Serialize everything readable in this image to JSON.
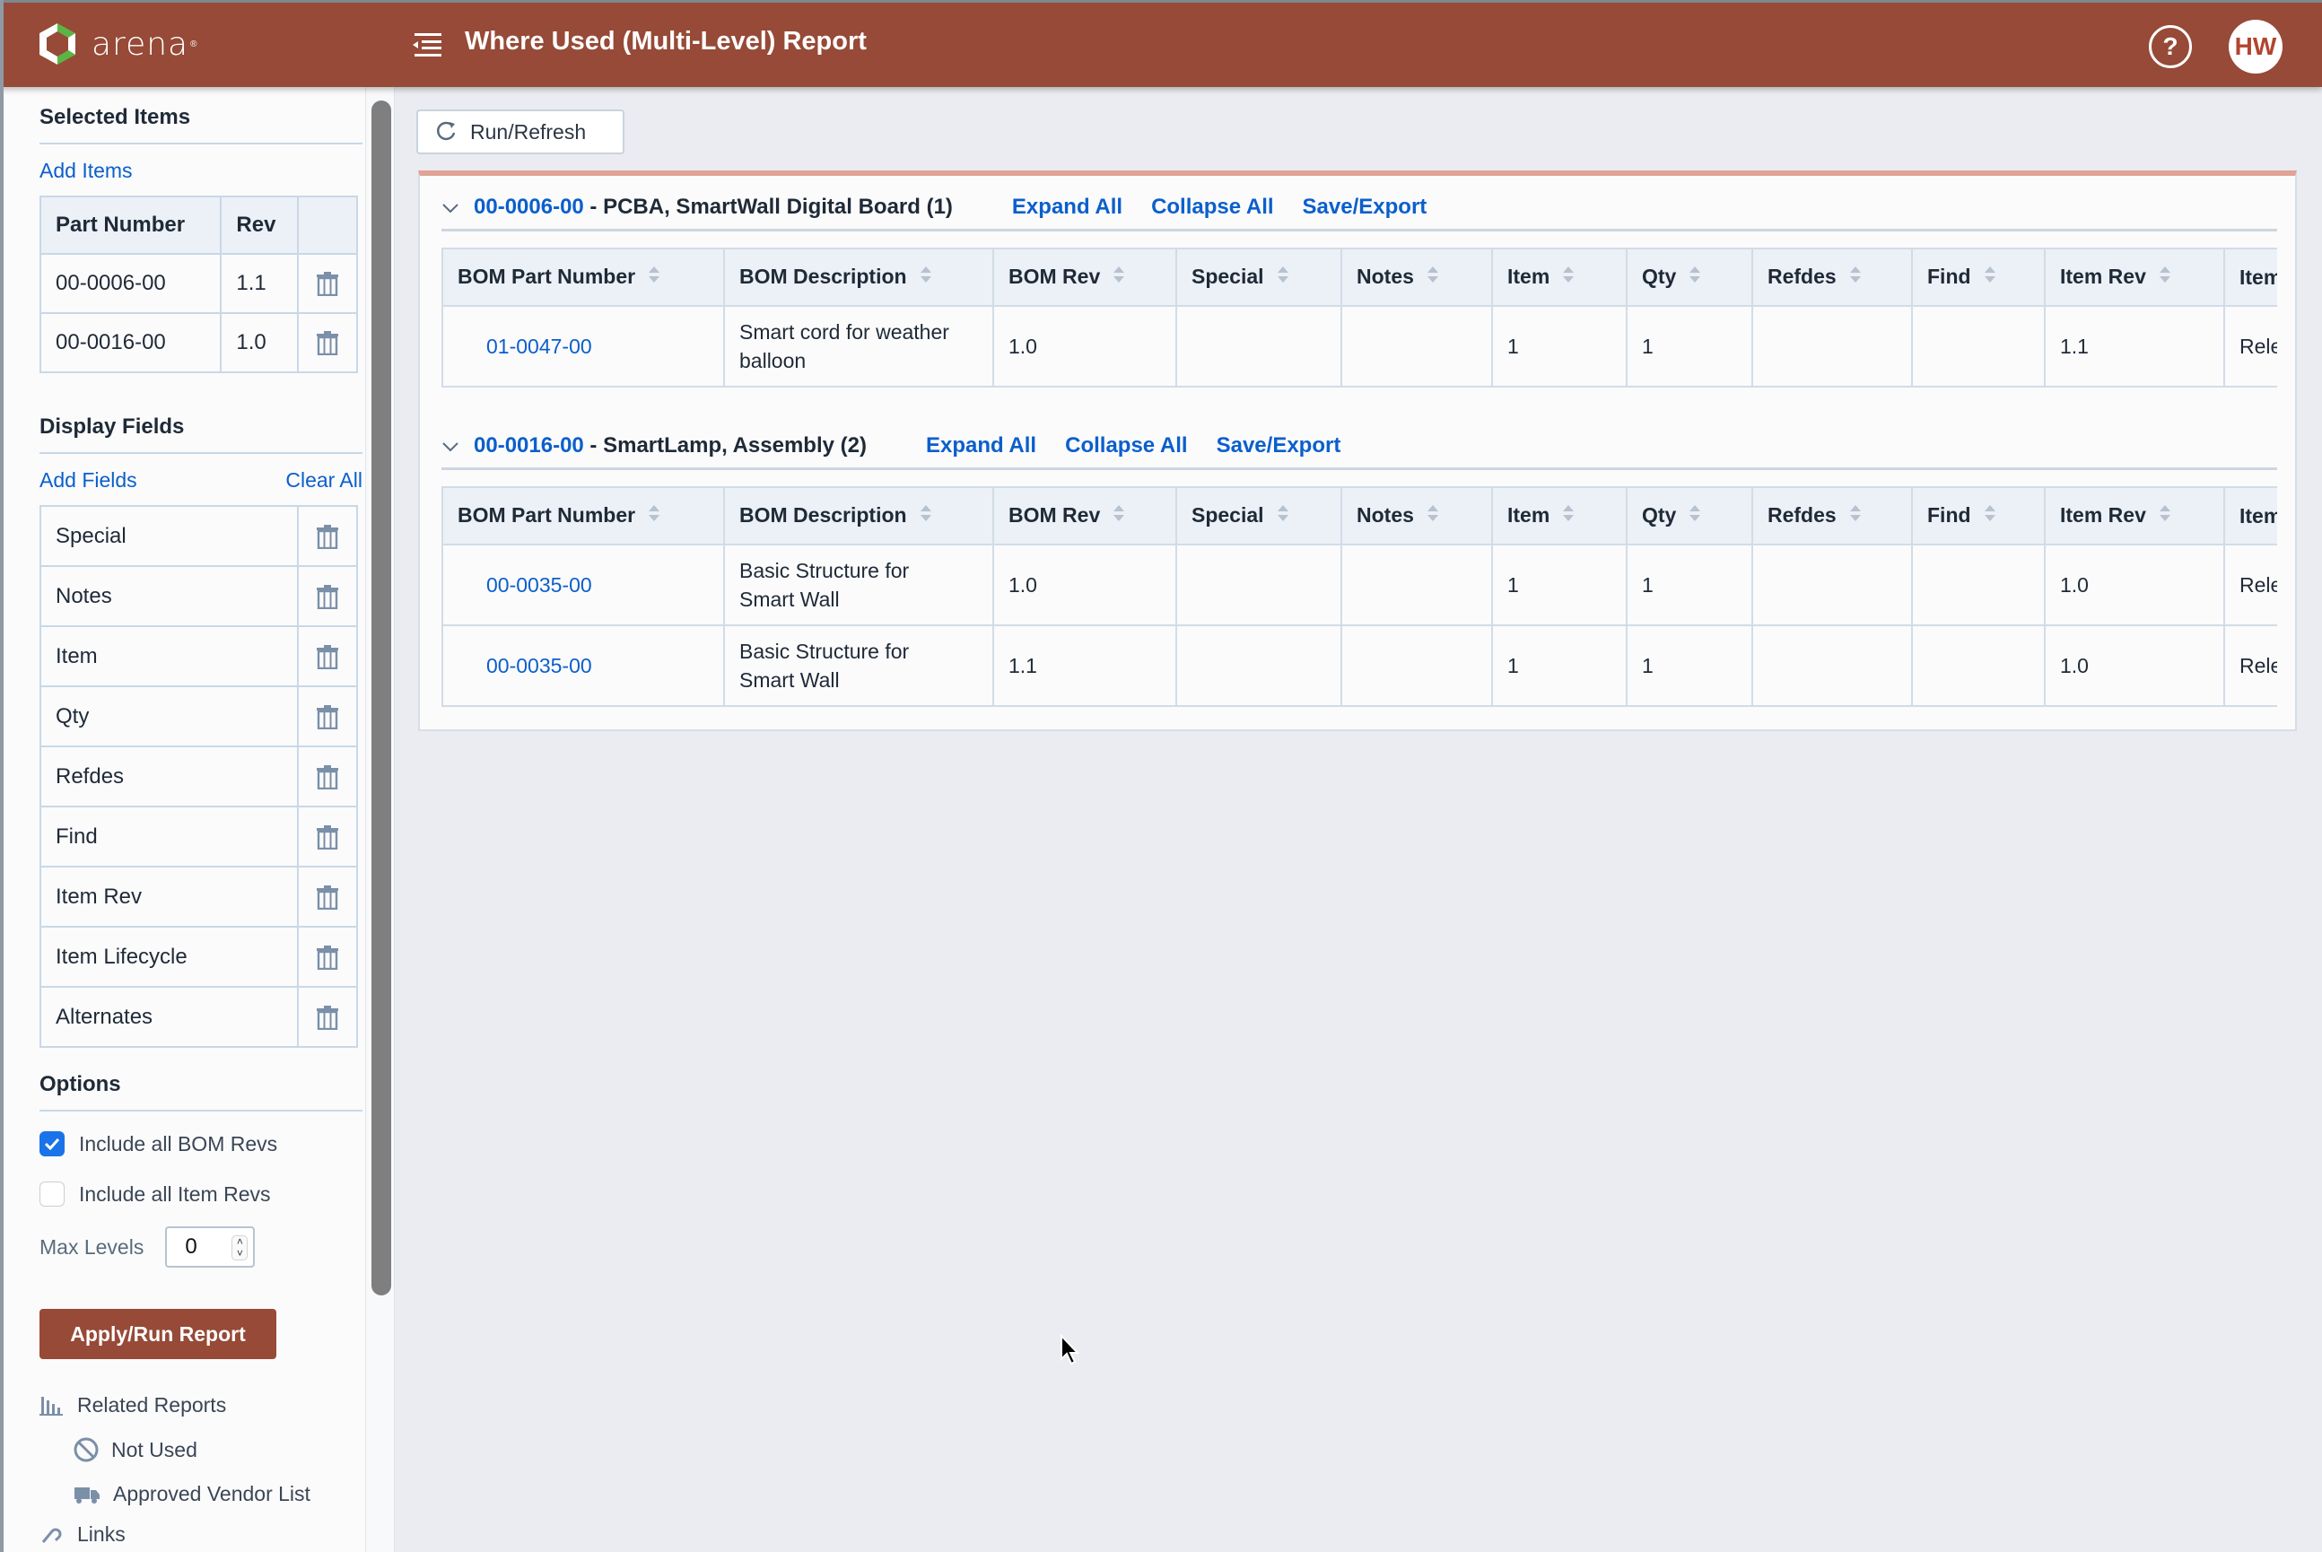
{
  "app": {
    "brand": "arena",
    "brand_mark": "®",
    "title": "Where Used (Multi-Level) Report",
    "help_label": "?",
    "user_initials": "HW",
    "colors": {
      "header": "#964a37",
      "link": "#0b5fcc",
      "accent_border": "#e0a395",
      "checkbox": "#1a73e8"
    }
  },
  "sidebar": {
    "selected_items": {
      "heading": "Selected Items",
      "add_link": "Add Items",
      "columns": [
        "Part Number",
        "Rev"
      ],
      "rows": [
        {
          "part": "00-0006-00",
          "rev": "1.1"
        },
        {
          "part": "00-0016-00",
          "rev": "1.0"
        }
      ]
    },
    "display_fields": {
      "heading": "Display Fields",
      "add_link": "Add Fields",
      "clear_link": "Clear All",
      "fields": [
        "Special",
        "Notes",
        "Item",
        "Qty",
        "Refdes",
        "Find",
        "Item Rev",
        "Item Lifecycle",
        "Alternates"
      ]
    },
    "options": {
      "heading": "Options",
      "include_bom_revs": {
        "label": "Include all BOM Revs",
        "checked": true
      },
      "include_item_revs": {
        "label": "Include all Item Revs",
        "checked": false
      },
      "max_levels_label": "Max Levels",
      "max_levels_value": "0"
    },
    "apply_button": "Apply/Run Report",
    "related_reports": {
      "heading": "Related Reports",
      "items": [
        {
          "label": "Not Used",
          "icon": "not-allowed-icon"
        },
        {
          "label": "Approved Vendor List",
          "icon": "truck-icon"
        }
      ],
      "next_partial": "Links"
    }
  },
  "main": {
    "run_refresh": "Run/Refresh",
    "columns": [
      "BOM Part Number",
      "BOM Description",
      "BOM Rev",
      "Special",
      "Notes",
      "Item",
      "Qty",
      "Refdes",
      "Find",
      "Item Rev",
      "Item Lifecycle"
    ],
    "groups": [
      {
        "part": "00-0006-00",
        "desc": " - PCBA, SmartWall Digital Board (1)",
        "expand": "Expand All",
        "collapse": "Collapse All",
        "export": "Save/Export",
        "rows": [
          [
            "01-0047-00",
            "Smart cord for weather balloon",
            "1.0",
            "",
            "",
            "1",
            "1",
            "",
            "",
            "1.1",
            "Released"
          ]
        ]
      },
      {
        "part": "00-0016-00",
        "desc": " - SmartLamp, Assembly (2)",
        "expand": "Expand All",
        "collapse": "Collapse All",
        "export": "Save/Export",
        "rows": [
          [
            "00-0035-00",
            "Basic Structure for Smart Wall",
            "1.0",
            "",
            "",
            "1",
            "1",
            "",
            "",
            "1.0",
            "Released"
          ],
          [
            "00-0035-00",
            "Basic Structure for Smart Wall",
            "1.1",
            "",
            "",
            "1",
            "1",
            "",
            "",
            "1.0",
            "Released"
          ]
        ]
      }
    ]
  }
}
